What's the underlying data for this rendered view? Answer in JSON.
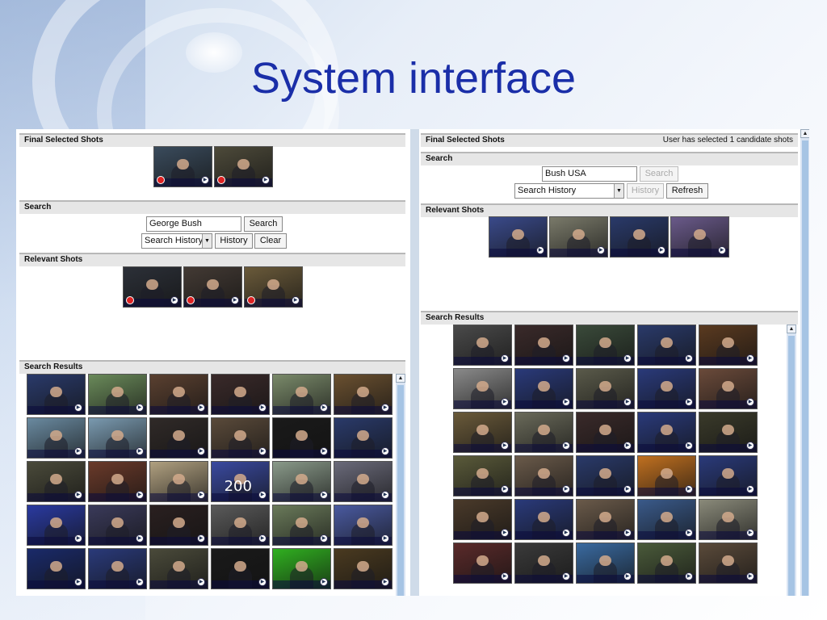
{
  "slide": {
    "title": "System interface"
  },
  "colors": {
    "accent": "#1a2ea8",
    "section": "#e6e6e6",
    "scrollbar": "#a6c4e4"
  },
  "left_panel": {
    "final_selected": {
      "label": "Final Selected Shots",
      "shots": [
        {
          "tone": "#3a4b5c",
          "overlay": ""
        },
        {
          "tone": "#4d4a3a",
          "overlay": ""
        }
      ]
    },
    "search": {
      "label": "Search",
      "query": "George Bush",
      "search_button": "Search",
      "history_select": "Search History",
      "history_button": "History",
      "clear_button": "Clear"
    },
    "relevant": {
      "label": "Relevant Shots",
      "shots": [
        {
          "tone": "#2c3038",
          "overlay": ""
        },
        {
          "tone": "#433a34",
          "overlay": ""
        },
        {
          "tone": "#6a5a3a",
          "overlay": ""
        }
      ]
    },
    "results": {
      "label": "Search Results",
      "rows": [
        [
          "#2a3a6a",
          "#6a8a5a",
          "#5a4030",
          "#3a2a2a",
          "#7a8a6a",
          "#6a5030"
        ],
        [
          "#6a8aa0",
          "#7a9ab0",
          "#302a28",
          "#5a4a3a",
          "#1a1a1a",
          "#2a3a6a"
        ],
        [
          "#4a4a3a",
          "#6a3a2a",
          "#b0a080",
          "#3a4aa0",
          "#8a9a8a",
          "#6a6a7a"
        ],
        [
          "#2a3aa0",
          "#3a3a5a",
          "#2a2020",
          "#5a5a5a",
          "#6a7a5a",
          "#4a5aa0"
        ],
        [
          "#1a2a6a",
          "#2a3a7a",
          "#4a4a3a",
          "#1a1a1a",
          "#30b020",
          "#4a3a20"
        ]
      ],
      "overlays": [
        "",
        "",
        "",
        "",
        "",
        "",
        "",
        "",
        "",
        "",
        "",
        "",
        "",
        "",
        "",
        "200",
        "",
        ""
      ]
    }
  },
  "right_panel": {
    "final_selected": {
      "label": "Final Selected Shots",
      "status": "User has selected 1 candidate shots"
    },
    "search": {
      "label": "Search",
      "query": "Bush USA",
      "search_button": "Search",
      "history_select": "Search History",
      "history_button": "History",
      "refresh_button": "Refresh"
    },
    "relevant": {
      "label": "Relevant Shots",
      "shots": [
        {
          "tone": "#3a4a8a"
        },
        {
          "tone": "#7a7a6a"
        },
        {
          "tone": "#2a3a6a"
        },
        {
          "tone": "#6a5a8a"
        }
      ]
    },
    "results": {
      "label": "Search Results",
      "rows": [
        [
          "#4a4a4a",
          "#3a2a2a",
          "#3a4a3a",
          "#2a3a6a",
          "#5a3a20"
        ],
        [
          "#8a8a8a",
          "#2a3a7a",
          "#5a5a4a",
          "#2a3a7a",
          "#6a4a3a"
        ],
        [
          "#6a5a3a",
          "#6a6a5a",
          "#3a2a2a",
          "#2a3a7a",
          "#3a3a2a"
        ],
        [
          "#5a5a3a",
          "#6a5a4a",
          "#2a3a6a",
          "#c07020",
          "#2a3a7a"
        ],
        [
          "#4a3a2a",
          "#2a3a7a",
          "#6a5a4a",
          "#3a5a8a",
          "#8a8a7a"
        ],
        [
          "#5a2a2a",
          "#3a3a3a",
          "#3a6aa0",
          "#4a5a3a",
          "#5a4a3a"
        ]
      ]
    }
  }
}
